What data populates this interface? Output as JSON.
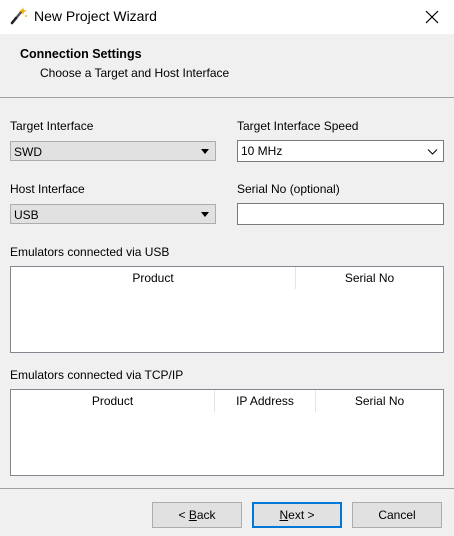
{
  "window": {
    "title": "New Project Wizard",
    "icons": {
      "app": "magic-wand-icon",
      "close": "close-icon"
    }
  },
  "header": {
    "title": "Connection Settings",
    "subtitle": "Choose a Target and Host Interface"
  },
  "form": {
    "target_interface": {
      "label": "Target Interface",
      "value": "SWD"
    },
    "target_speed": {
      "label": "Target Interface Speed",
      "value": "10 MHz"
    },
    "host_interface": {
      "label": "Host Interface",
      "value": "USB"
    },
    "serial_no": {
      "label": "Serial No (optional)",
      "value": ""
    }
  },
  "usb_emulators": {
    "label": "Emulators connected via USB",
    "columns": [
      "Product",
      "Serial No"
    ],
    "rows": []
  },
  "tcpip_emulators": {
    "label": "Emulators connected via TCP/IP",
    "columns": [
      "Product",
      "IP Address",
      "Serial No"
    ],
    "rows": []
  },
  "buttons": {
    "back": {
      "prefix": "< ",
      "mnemonic": "B",
      "rest": "ack"
    },
    "next": {
      "mnemonic": "N",
      "rest": "ext >"
    },
    "cancel": "Cancel"
  },
  "colors": {
    "default_button_border": "#0078d7",
    "dialog_background": "#f0f0f0"
  }
}
